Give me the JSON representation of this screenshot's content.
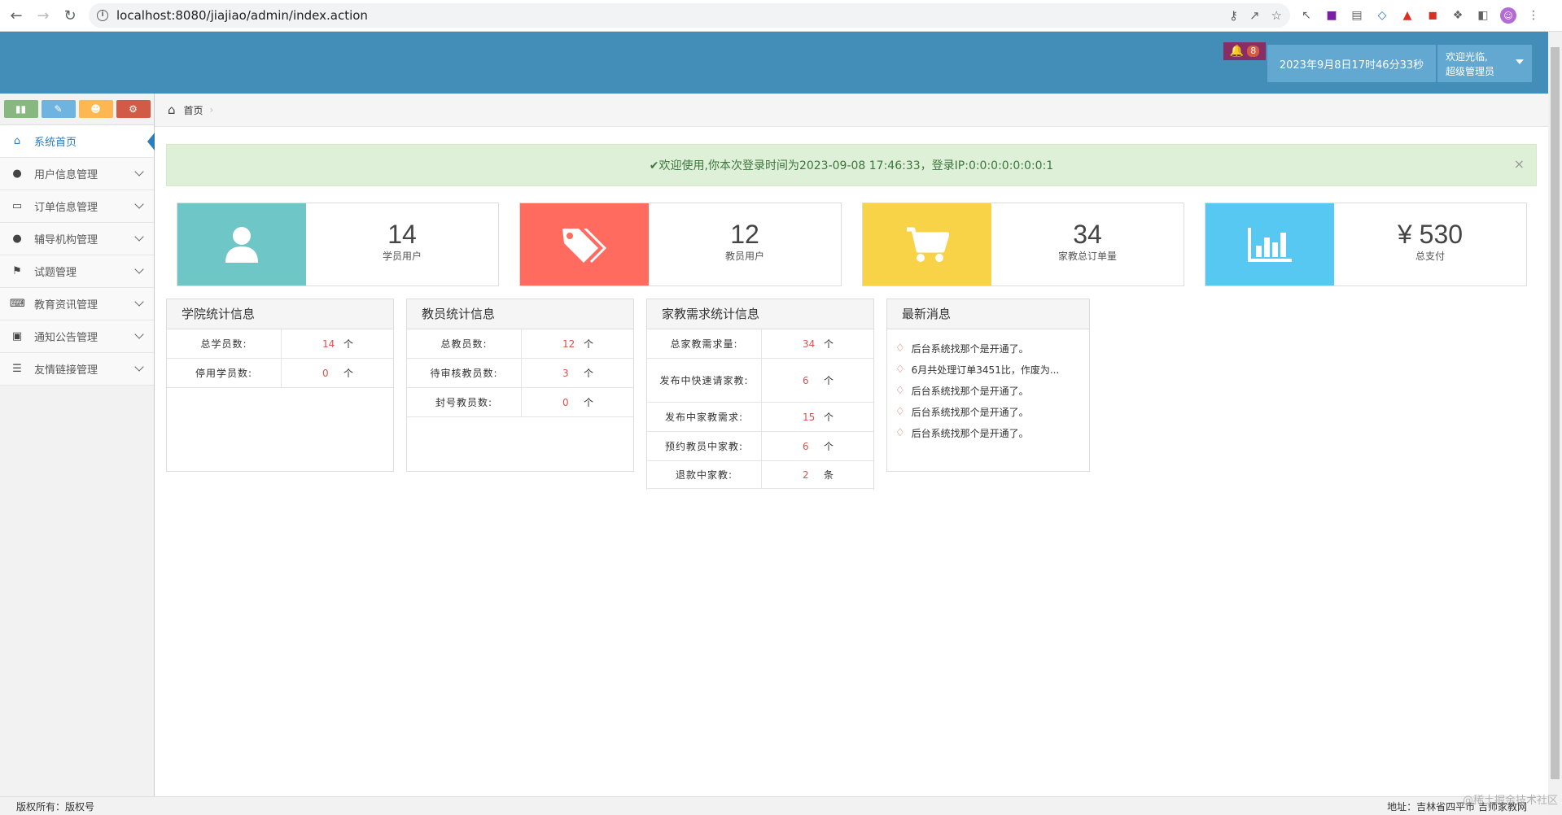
{
  "browser": {
    "url": "localhost:8080/jiajiao/admin/index.action"
  },
  "header": {
    "notification_count": "8",
    "datetime": "2023年9月8日17时46分33秒",
    "welcome": "欢迎光临,",
    "role": "超级管理员"
  },
  "sidebar": {
    "items": [
      {
        "label": "系统首页",
        "icon": "home-icon"
      },
      {
        "label": "用户信息管理",
        "icon": "user-icon"
      },
      {
        "label": "订单信息管理",
        "icon": "credit-card-icon"
      },
      {
        "label": "辅导机构管理",
        "icon": "user-icon"
      },
      {
        "label": "试题管理",
        "icon": "bookmark-icon"
      },
      {
        "label": "教育资讯管理",
        "icon": "comments-icon"
      },
      {
        "label": "通知公告管理",
        "icon": "desktop-icon"
      },
      {
        "label": "友情链接管理",
        "icon": "list-icon"
      }
    ]
  },
  "breadcrumb": {
    "home": "首页"
  },
  "alert": {
    "text": "✔欢迎使用,你本次登录时间为2023-09-08 17:46:33，登录IP:0:0:0:0:0:0:0:1",
    "close": "×"
  },
  "stats": [
    {
      "value": "14",
      "label": "学员用户",
      "color": "#6fc6c7",
      "icon": "user-icon"
    },
    {
      "value": "12",
      "label": "教员用户",
      "color": "#ff6b5f",
      "icon": "tags-icon"
    },
    {
      "value": "34",
      "label": "家教总订单量",
      "color": "#f8d347",
      "icon": "cart-icon"
    },
    {
      "value": "¥ 530",
      "label": "总支付",
      "color": "#57c8f2",
      "icon": "bar-chart-icon"
    }
  ],
  "panels": {
    "college": {
      "title": "学院统计信息",
      "rows": [
        {
          "label": "总学员数:",
          "value": "14",
          "unit": "个"
        },
        {
          "label": "停用学员数:",
          "value": "0",
          "unit": "个"
        }
      ]
    },
    "teacher": {
      "title": "教员统计信息",
      "rows": [
        {
          "label": "总教员数:",
          "value": "12",
          "unit": "个"
        },
        {
          "label": "待审核教员数:",
          "value": "3",
          "unit": "个"
        },
        {
          "label": "封号教员数:",
          "value": "0",
          "unit": "个"
        }
      ]
    },
    "demand": {
      "title": "家教需求统计信息",
      "rows": [
        {
          "label": "总家教需求量:",
          "value": "34",
          "unit": "个"
        },
        {
          "label": "发布中快速请家教:",
          "value": "6",
          "unit": "个"
        },
        {
          "label": "发布中家教需求:",
          "value": "15",
          "unit": "个"
        },
        {
          "label": "预约教员中家教:",
          "value": "6",
          "unit": "个"
        },
        {
          "label": "退款中家教:",
          "value": "2",
          "unit": "条"
        }
      ]
    },
    "news": {
      "title": "最新消息",
      "items": [
        "后台系统找那个是开通了。",
        "6月共处理订单3451比，作废为...",
        "后台系统找那个是开通了。",
        "后台系统找那个是开通了。",
        "后台系统找那个是开通了。"
      ]
    }
  },
  "footer": {
    "left": "版权所有：版权号",
    "right": "地址：吉林省四平市 吉师家教网"
  },
  "watermark": "@稀土掘金技术社区"
}
